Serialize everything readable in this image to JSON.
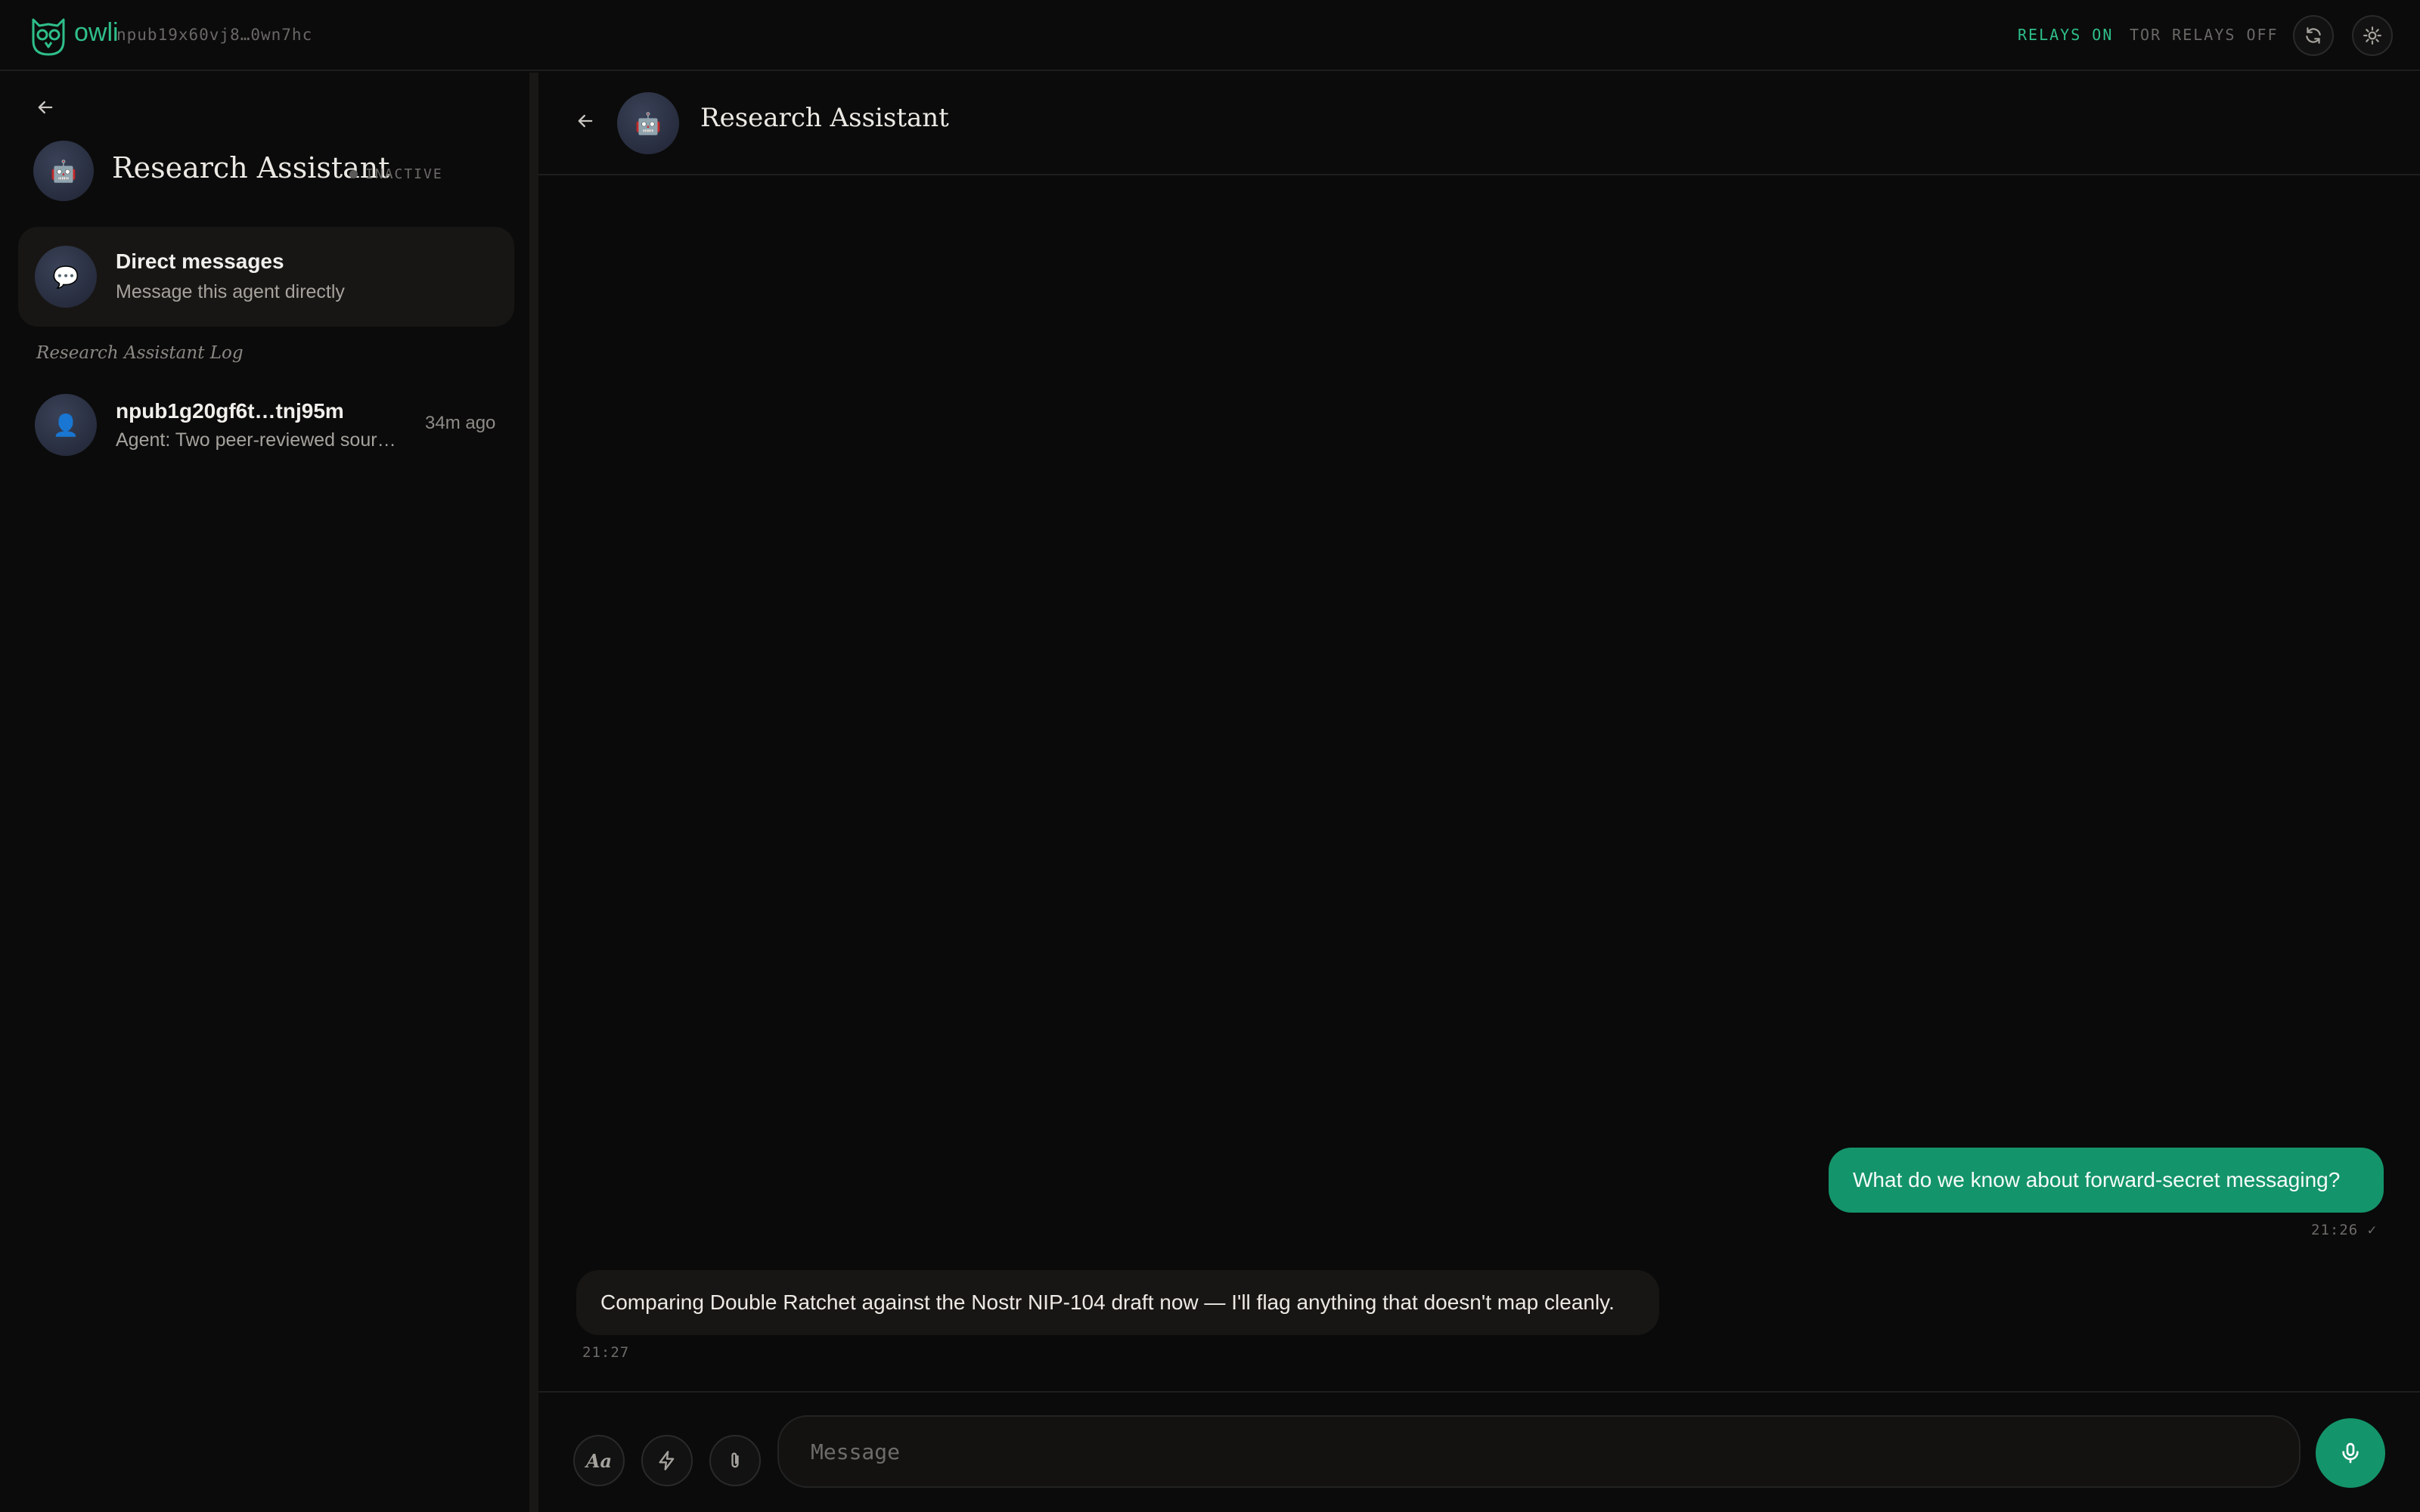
{
  "app": {
    "logo_text": "owli",
    "npub": "npub19x60vj8…0wn7hc",
    "relays_on": "RELAYS ON",
    "tor_relays_off": "TOR RELAYS OFF",
    "accent_color": "#14946a"
  },
  "sidebar": {
    "agent_name": "Research Assistant",
    "agent_avatar": "🤖",
    "status": "INACTIVE",
    "direct_messages": {
      "title": "Direct messages",
      "subtitle": "Message this agent directly",
      "icon": "💬"
    },
    "log_heading": "Research Assistant Log",
    "conversations": [
      {
        "title": "npub1g20gf6t…tnj95m",
        "preview": "Agent: Two peer-reviewed sources",
        "time": "34m ago",
        "icon": "👤"
      }
    ]
  },
  "chat": {
    "title": "Research Assistant",
    "avatar": "🤖",
    "messages": [
      {
        "direction": "outgoing",
        "text": "What do we know about forward-secret messaging?",
        "time": "21:26 ✓"
      },
      {
        "direction": "incoming",
        "text": "Comparing Double Ratchet against the Nostr NIP-104 draft now — I'll flag anything that doesn't map cleanly.",
        "time": "21:27"
      }
    ]
  },
  "composer": {
    "format_label": "Aa",
    "placeholder": "Message"
  }
}
